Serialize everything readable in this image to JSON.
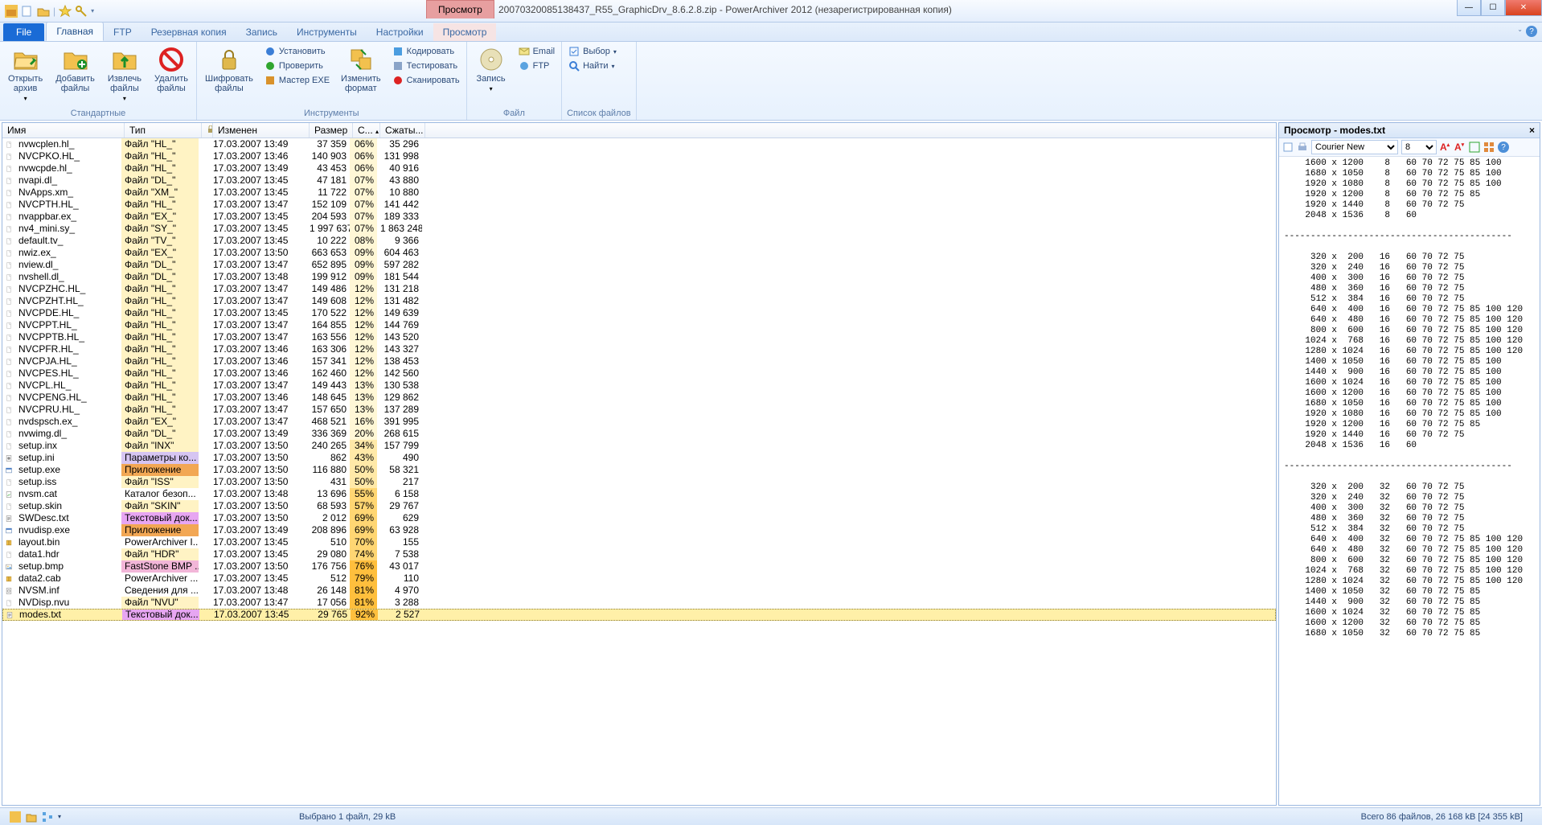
{
  "window": {
    "context_tab": "Просмотр",
    "title": "20070320085138437_R55_GraphicDrv_8.6.2.8.zip - PowerArchiver 2012  (незарегистрированная копия)"
  },
  "tabs": {
    "file": "File",
    "items": [
      "Главная",
      "FTP",
      "Резервная копия",
      "Запись",
      "Инструменты",
      "Настройки",
      "Просмотр"
    ],
    "active_index": 0
  },
  "ribbon": {
    "group_standard": {
      "label": "Стандартные",
      "open": "Открыть\nархив",
      "add": "Добавить\nфайлы",
      "extract": "Извлечь\nфайлы",
      "delete": "Удалить\nфайлы"
    },
    "group_tools": {
      "label": "Инструменты",
      "encrypt": "Шифровать\nфайлы",
      "install": "Установить",
      "check": "Проверить",
      "wizard": "Мастер EXE",
      "convert": "Изменить\nформат",
      "encode": "Кодировать",
      "test": "Тестировать",
      "scan": "Сканировать"
    },
    "group_file": {
      "label": "Файл",
      "write": "Запись",
      "email": "Email",
      "ftp": "FTP"
    },
    "group_list": {
      "label": "Список файлов",
      "select": "Выбор",
      "find": "Найти"
    }
  },
  "columns": {
    "name": "Имя",
    "type": "Тип",
    "lock": "",
    "modified": "Изменен",
    "size": "Размер",
    "pct": "С...",
    "comp": "Сжаты..."
  },
  "rows": [
    {
      "ico": "file",
      "name": "nvwcplen.hl_",
      "type": "Файл \"HL_\"",
      "tclass": "t-hl",
      "mod": "17.03.2007 13:49",
      "size": "37 359",
      "pct": "06%",
      "pclass": "p-low",
      "comp": "35 296"
    },
    {
      "ico": "file",
      "name": "NVCPKO.HL_",
      "type": "Файл \"HL_\"",
      "tclass": "t-hl",
      "mod": "17.03.2007 13:46",
      "size": "140 903",
      "pct": "06%",
      "pclass": "p-low",
      "comp": "131 998"
    },
    {
      "ico": "file",
      "name": "nvwcpde.hl_",
      "type": "Файл \"HL_\"",
      "tclass": "t-hl",
      "mod": "17.03.2007 13:49",
      "size": "43 453",
      "pct": "06%",
      "pclass": "p-low",
      "comp": "40 916"
    },
    {
      "ico": "file",
      "name": "nvapi.dl_",
      "type": "Файл \"DL_\"",
      "tclass": "t-dl",
      "mod": "17.03.2007 13:45",
      "size": "47 181",
      "pct": "07%",
      "pclass": "p-low",
      "comp": "43 880"
    },
    {
      "ico": "file",
      "name": "NvApps.xm_",
      "type": "Файл \"XM_\"",
      "tclass": "t-xm",
      "mod": "17.03.2007 13:45",
      "size": "11 722",
      "pct": "07%",
      "pclass": "p-low",
      "comp": "10 880"
    },
    {
      "ico": "file",
      "name": "NVCPTH.HL_",
      "type": "Файл \"HL_\"",
      "tclass": "t-hl",
      "mod": "17.03.2007 13:47",
      "size": "152 109",
      "pct": "07%",
      "pclass": "p-low",
      "comp": "141 442"
    },
    {
      "ico": "file",
      "name": "nvappbar.ex_",
      "type": "Файл \"EX_\"",
      "tclass": "t-ex",
      "mod": "17.03.2007 13:45",
      "size": "204 593",
      "pct": "07%",
      "pclass": "p-low",
      "comp": "189 333"
    },
    {
      "ico": "file",
      "name": "nv4_mini.sy_",
      "type": "Файл \"SY_\"",
      "tclass": "t-sy",
      "mod": "17.03.2007 13:45",
      "size": "1 997 637",
      "pct": "07%",
      "pclass": "p-low",
      "comp": "1 863 248"
    },
    {
      "ico": "file",
      "name": "default.tv_",
      "type": "Файл \"TV_\"",
      "tclass": "t-tv",
      "mod": "17.03.2007 13:45",
      "size": "10 222",
      "pct": "08%",
      "pclass": "p-low",
      "comp": "9 366"
    },
    {
      "ico": "file",
      "name": "nwiz.ex_",
      "type": "Файл \"EX_\"",
      "tclass": "t-ex",
      "mod": "17.03.2007 13:50",
      "size": "663 653",
      "pct": "09%",
      "pclass": "p-low",
      "comp": "604 463"
    },
    {
      "ico": "file",
      "name": "nview.dl_",
      "type": "Файл \"DL_\"",
      "tclass": "t-dl",
      "mod": "17.03.2007 13:47",
      "size": "652 895",
      "pct": "09%",
      "pclass": "p-low",
      "comp": "597 282"
    },
    {
      "ico": "file",
      "name": "nvshell.dl_",
      "type": "Файл \"DL_\"",
      "tclass": "t-dl",
      "mod": "17.03.2007 13:48",
      "size": "199 912",
      "pct": "09%",
      "pclass": "p-low",
      "comp": "181 544"
    },
    {
      "ico": "file",
      "name": "NVCPZHC.HL_",
      "type": "Файл \"HL_\"",
      "tclass": "t-hl",
      "mod": "17.03.2007 13:47",
      "size": "149 486",
      "pct": "12%",
      "pclass": "p-low",
      "comp": "131 218"
    },
    {
      "ico": "file",
      "name": "NVCPZHT.HL_",
      "type": "Файл \"HL_\"",
      "tclass": "t-hl",
      "mod": "17.03.2007 13:47",
      "size": "149 608",
      "pct": "12%",
      "pclass": "p-low",
      "comp": "131 482"
    },
    {
      "ico": "file",
      "name": "NVCPDE.HL_",
      "type": "Файл \"HL_\"",
      "tclass": "t-hl",
      "mod": "17.03.2007 13:45",
      "size": "170 522",
      "pct": "12%",
      "pclass": "p-low",
      "comp": "149 639"
    },
    {
      "ico": "file",
      "name": "NVCPPT.HL_",
      "type": "Файл \"HL_\"",
      "tclass": "t-hl",
      "mod": "17.03.2007 13:47",
      "size": "164 855",
      "pct": "12%",
      "pclass": "p-low",
      "comp": "144 769"
    },
    {
      "ico": "file",
      "name": "NVCPPTB.HL_",
      "type": "Файл \"HL_\"",
      "tclass": "t-hl",
      "mod": "17.03.2007 13:47",
      "size": "163 556",
      "pct": "12%",
      "pclass": "p-low",
      "comp": "143 520"
    },
    {
      "ico": "file",
      "name": "NVCPFR.HL_",
      "type": "Файл \"HL_\"",
      "tclass": "t-hl",
      "mod": "17.03.2007 13:46",
      "size": "163 306",
      "pct": "12%",
      "pclass": "p-low",
      "comp": "143 327"
    },
    {
      "ico": "file",
      "name": "NVCPJA.HL_",
      "type": "Файл \"HL_\"",
      "tclass": "t-hl",
      "mod": "17.03.2007 13:46",
      "size": "157 341",
      "pct": "12%",
      "pclass": "p-low",
      "comp": "138 453"
    },
    {
      "ico": "file",
      "name": "NVCPES.HL_",
      "type": "Файл \"HL_\"",
      "tclass": "t-hl",
      "mod": "17.03.2007 13:46",
      "size": "162 460",
      "pct": "12%",
      "pclass": "p-low",
      "comp": "142 560"
    },
    {
      "ico": "file",
      "name": "NVCPL.HL_",
      "type": "Файл \"HL_\"",
      "tclass": "t-hl",
      "mod": "17.03.2007 13:47",
      "size": "149 443",
      "pct": "13%",
      "pclass": "p-low",
      "comp": "130 538"
    },
    {
      "ico": "file",
      "name": "NVCPENG.HL_",
      "type": "Файл \"HL_\"",
      "tclass": "t-hl",
      "mod": "17.03.2007 13:46",
      "size": "148 645",
      "pct": "13%",
      "pclass": "p-low",
      "comp": "129 862"
    },
    {
      "ico": "file",
      "name": "NVCPRU.HL_",
      "type": "Файл \"HL_\"",
      "tclass": "t-hl",
      "mod": "17.03.2007 13:47",
      "size": "157 650",
      "pct": "13%",
      "pclass": "p-low",
      "comp": "137 289"
    },
    {
      "ico": "file",
      "name": "nvdspsch.ex_",
      "type": "Файл \"EX_\"",
      "tclass": "t-ex",
      "mod": "17.03.2007 13:47",
      "size": "468 521",
      "pct": "16%",
      "pclass": "p-low",
      "comp": "391 995"
    },
    {
      "ico": "file",
      "name": "nvwimg.dl_",
      "type": "Файл \"DL_\"",
      "tclass": "t-dl",
      "mod": "17.03.2007 13:49",
      "size": "336 369",
      "pct": "20%",
      "pclass": "p-low",
      "comp": "268 615"
    },
    {
      "ico": "file",
      "name": "setup.inx",
      "type": "Файл \"INX\"",
      "tclass": "t-inx",
      "mod": "17.03.2007 13:50",
      "size": "240 265",
      "pct": "34%",
      "pclass": "p-mid",
      "comp": "157 799"
    },
    {
      "ico": "ini",
      "name": "setup.ini",
      "type": "Параметры ко...",
      "tclass": "t-param",
      "mod": "17.03.2007 13:50",
      "size": "862",
      "pct": "43%",
      "pclass": "p-mid",
      "comp": "490"
    },
    {
      "ico": "exe",
      "name": "setup.exe",
      "type": "Приложение",
      "tclass": "t-app",
      "mod": "17.03.2007 13:50",
      "size": "116 880",
      "pct": "50%",
      "pclass": "p-mid",
      "comp": "58 321"
    },
    {
      "ico": "file",
      "name": "setup.iss",
      "type": "Файл \"ISS\"",
      "tclass": "t-iss",
      "mod": "17.03.2007 13:50",
      "size": "431",
      "pct": "50%",
      "pclass": "p-mid",
      "comp": "217"
    },
    {
      "ico": "cat",
      "name": "nvsm.cat",
      "type": "Каталог безоп...",
      "tclass": "",
      "mod": "17.03.2007 13:48",
      "size": "13 696",
      "pct": "55%",
      "pclass": "p-high",
      "comp": "6 158"
    },
    {
      "ico": "file",
      "name": "setup.skin",
      "type": "Файл \"SKIN\"",
      "tclass": "t-skin",
      "mod": "17.03.2007 13:50",
      "size": "68 593",
      "pct": "57%",
      "pclass": "p-high",
      "comp": "29 767"
    },
    {
      "ico": "txt",
      "name": "SWDesc.txt",
      "type": "Текстовый док...",
      "tclass": "t-txt",
      "mod": "17.03.2007 13:50",
      "size": "2 012",
      "pct": "69%",
      "pclass": "p-high",
      "comp": "629"
    },
    {
      "ico": "exe",
      "name": "nvudisp.exe",
      "type": "Приложение",
      "tclass": "t-app",
      "mod": "17.03.2007 13:49",
      "size": "208 896",
      "pct": "69%",
      "pclass": "p-high",
      "comp": "63 928"
    },
    {
      "ico": "pa",
      "name": "layout.bin",
      "type": "PowerArchiver I...",
      "tclass": "",
      "mod": "17.03.2007 13:45",
      "size": "510",
      "pct": "70%",
      "pclass": "p-high",
      "comp": "155"
    },
    {
      "ico": "file",
      "name": "data1.hdr",
      "type": "Файл \"HDR\"",
      "tclass": "t-hdr",
      "mod": "17.03.2007 13:45",
      "size": "29 080",
      "pct": "74%",
      "pclass": "p-high",
      "comp": "7 538"
    },
    {
      "ico": "bmp",
      "name": "setup.bmp",
      "type": "FastStone BMP ...",
      "tclass": "t-bmp",
      "mod": "17.03.2007 13:50",
      "size": "176 756",
      "pct": "76%",
      "pclass": "p-vhigh",
      "comp": "43 017"
    },
    {
      "ico": "pa",
      "name": "data2.cab",
      "type": "PowerArchiver ...",
      "tclass": "",
      "mod": "17.03.2007 13:45",
      "size": "512",
      "pct": "79%",
      "pclass": "p-vhigh",
      "comp": "110"
    },
    {
      "ico": "inf",
      "name": "NVSM.inf",
      "type": "Сведения для ...",
      "tclass": "",
      "mod": "17.03.2007 13:48",
      "size": "26 148",
      "pct": "81%",
      "pclass": "p-vhigh",
      "comp": "4 970"
    },
    {
      "ico": "file",
      "name": "NVDisp.nvu",
      "type": "Файл \"NVU\"",
      "tclass": "t-nvu",
      "mod": "17.03.2007 13:47",
      "size": "17 056",
      "pct": "81%",
      "pclass": "p-vhigh",
      "comp": "3 288"
    },
    {
      "ico": "txt",
      "name": "modes.txt",
      "type": "Текстовый док...",
      "tclass": "t-txt",
      "mod": "17.03.2007 13:45",
      "size": "29 765",
      "pct": "92%",
      "pclass": "p-vhigh",
      "comp": "2 527",
      "selected": true
    }
  ],
  "preview": {
    "title": "Просмотр - modes.txt",
    "font": "Courier New",
    "size": "8",
    "text": "    1600 x 1200    8   60 70 72 75 85 100\n    1680 x 1050    8   60 70 72 75 85 100\n    1920 x 1080    8   60 70 72 75 85 100\n    1920 x 1200    8   60 70 72 75 85\n    1920 x 1440    8   60 70 72 75\n    2048 x 1536    8   60\n\n-------------------------------------------\n\n     320 x  200   16   60 70 72 75\n     320 x  240   16   60 70 72 75\n     400 x  300   16   60 70 72 75\n     480 x  360   16   60 70 72 75\n     512 x  384   16   60 70 72 75\n     640 x  400   16   60 70 72 75 85 100 120\n     640 x  480   16   60 70 72 75 85 100 120\n     800 x  600   16   60 70 72 75 85 100 120\n    1024 x  768   16   60 70 72 75 85 100 120\n    1280 x 1024   16   60 70 72 75 85 100 120\n    1400 x 1050   16   60 70 72 75 85 100\n    1440 x  900   16   60 70 72 75 85 100\n    1600 x 1024   16   60 70 72 75 85 100\n    1600 x 1200   16   60 70 72 75 85 100\n    1680 x 1050   16   60 70 72 75 85 100\n    1920 x 1080   16   60 70 72 75 85 100\n    1920 x 1200   16   60 70 72 75 85\n    1920 x 1440   16   60 70 72 75\n    2048 x 1536   16   60\n\n-------------------------------------------\n\n     320 x  200   32   60 70 72 75\n     320 x  240   32   60 70 72 75\n     400 x  300   32   60 70 72 75\n     480 x  360   32   60 70 72 75\n     512 x  384   32   60 70 72 75\n     640 x  400   32   60 70 72 75 85 100 120\n     640 x  480   32   60 70 72 75 85 100 120\n     800 x  600   32   60 70 72 75 85 100 120\n    1024 x  768   32   60 70 72 75 85 100 120\n    1280 x 1024   32   60 70 72 75 85 100 120\n    1400 x 1050   32   60 70 72 75 85\n    1440 x  900   32   60 70 72 75 85\n    1600 x 1024   32   60 70 72 75 85\n    1600 x 1200   32   60 70 72 75 85\n    1680 x 1050   32   60 70 72 75 85"
  },
  "status": {
    "selection": "Выбрано 1 файл, 29 kB",
    "total": "Всего 86 файлов, 26 168 kB [24 355 kB]"
  }
}
